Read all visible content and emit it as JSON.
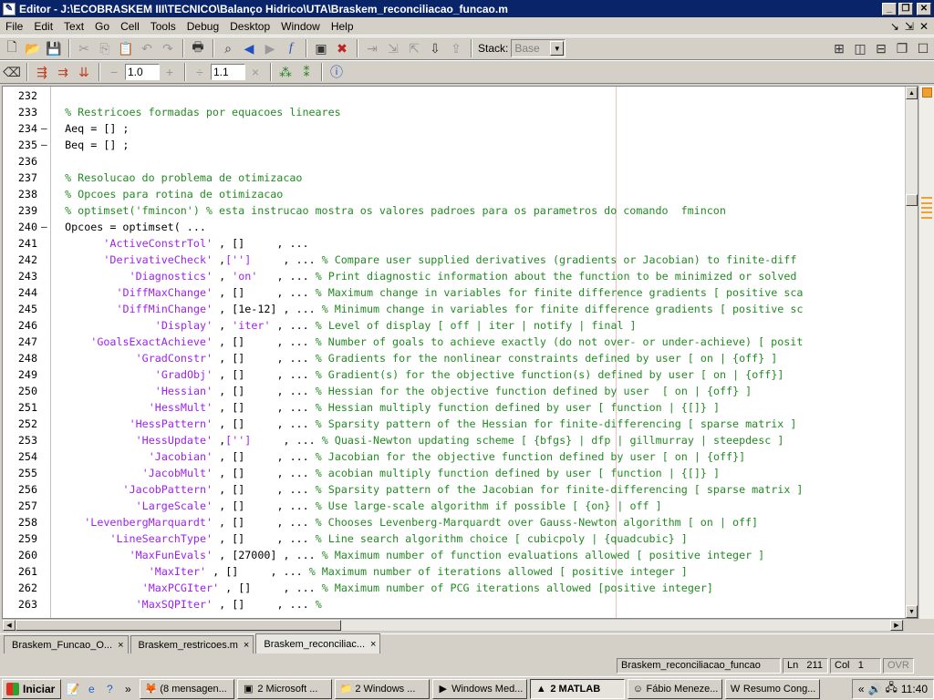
{
  "window": {
    "title": "Editor - J:\\ECOBRASKEM III\\TECNICO\\Balanço Hidrico\\UTA\\Braskem_reconciliacao_funcao.m"
  },
  "menu": [
    "File",
    "Edit",
    "Text",
    "Go",
    "Cell",
    "Tools",
    "Debug",
    "Desktop",
    "Window",
    "Help"
  ],
  "toolbar": {
    "stack_label": "Stack:",
    "stack_value": "Base",
    "cell_minus_value": "1.0",
    "cell_divide_value": "1.1"
  },
  "code_lines": [
    {
      "n": "232",
      "dash": "",
      "indent": 0,
      "parts": []
    },
    {
      "n": "233",
      "dash": "",
      "indent": 2,
      "parts": [
        {
          "t": "% Restricoes formadas por equacoes lineares",
          "c": "cm"
        }
      ]
    },
    {
      "n": "234",
      "dash": "—",
      "indent": 2,
      "parts": [
        {
          "t": "Aeq = [] ;",
          "c": "txt"
        }
      ]
    },
    {
      "n": "235",
      "dash": "—",
      "indent": 2,
      "parts": [
        {
          "t": "Beq = [] ;",
          "c": "txt"
        }
      ]
    },
    {
      "n": "236",
      "dash": "",
      "indent": 0,
      "parts": []
    },
    {
      "n": "237",
      "dash": "",
      "indent": 2,
      "parts": [
        {
          "t": "% Resolucao do problema de otimizacao",
          "c": "cm"
        }
      ]
    },
    {
      "n": "238",
      "dash": "",
      "indent": 2,
      "parts": [
        {
          "t": "% Opcoes para rotina de otimizacao",
          "c": "cm"
        }
      ]
    },
    {
      "n": "239",
      "dash": "",
      "indent": 2,
      "parts": [
        {
          "t": "% optimset('fmincon') % esta instrucao mostra os valores padroes para os parametros do comando  fmincon",
          "c": "cm"
        }
      ]
    },
    {
      "n": "240",
      "dash": "—",
      "indent": 2,
      "parts": [
        {
          "t": "Opcoes = optimset( ...",
          "c": "txt"
        }
      ]
    },
    {
      "n": "241",
      "dash": "",
      "indent": 8,
      "parts": [
        {
          "t": "'ActiveConstrTol'",
          "c": "str"
        },
        {
          "t": " , []     , ...",
          "c": "txt"
        }
      ]
    },
    {
      "n": "242",
      "dash": "",
      "indent": 8,
      "parts": [
        {
          "t": "'DerivativeCheck'",
          "c": "str"
        },
        {
          "t": " ,",
          "c": "txt"
        },
        {
          "t": "['']",
          "c": "str"
        },
        {
          "t": "     , ... ",
          "c": "txt"
        },
        {
          "t": "% Compare user supplied derivatives (gradients or Jacobian) to finite-diff",
          "c": "cm"
        }
      ]
    },
    {
      "n": "243",
      "dash": "",
      "indent": 12,
      "parts": [
        {
          "t": "'Diagnostics'",
          "c": "str"
        },
        {
          "t": " , ",
          "c": "txt"
        },
        {
          "t": "'on'",
          "c": "str"
        },
        {
          "t": "   , ... ",
          "c": "txt"
        },
        {
          "t": "% Print diagnostic information about the function to be minimized or solved",
          "c": "cm"
        }
      ]
    },
    {
      "n": "244",
      "dash": "",
      "indent": 10,
      "parts": [
        {
          "t": "'DiffMaxChange'",
          "c": "str"
        },
        {
          "t": " , []     , ... ",
          "c": "txt"
        },
        {
          "t": "% Maximum change in variables for finite difference gradients [ positive sca",
          "c": "cm"
        }
      ]
    },
    {
      "n": "245",
      "dash": "",
      "indent": 10,
      "parts": [
        {
          "t": "'DiffMinChange'",
          "c": "str"
        },
        {
          "t": " , [1e-12] , ... ",
          "c": "txt"
        },
        {
          "t": "% Minimum change in variables for finite difference gradients [ positive sc",
          "c": "cm"
        }
      ]
    },
    {
      "n": "246",
      "dash": "",
      "indent": 16,
      "parts": [
        {
          "t": "'Display'",
          "c": "str"
        },
        {
          "t": " , ",
          "c": "txt"
        },
        {
          "t": "'iter'",
          "c": "str"
        },
        {
          "t": " , ... ",
          "c": "txt"
        },
        {
          "t": "% Level of display [ off | iter | notify | final ]",
          "c": "cm"
        }
      ]
    },
    {
      "n": "247",
      "dash": "",
      "indent": 6,
      "parts": [
        {
          "t": "'GoalsExactAchieve'",
          "c": "str"
        },
        {
          "t": " , []     , ... ",
          "c": "txt"
        },
        {
          "t": "% Number of goals to achieve exactly (do not over- or under-achieve) [ posit",
          "c": "cm"
        }
      ]
    },
    {
      "n": "248",
      "dash": "",
      "indent": 13,
      "parts": [
        {
          "t": "'GradConstr'",
          "c": "str"
        },
        {
          "t": " , []     , ... ",
          "c": "txt"
        },
        {
          "t": "% Gradients for the nonlinear constraints defined by user [ on | {off} ]",
          "c": "cm"
        }
      ]
    },
    {
      "n": "249",
      "dash": "",
      "indent": 16,
      "parts": [
        {
          "t": "'GradObj'",
          "c": "str"
        },
        {
          "t": " , []     , ... ",
          "c": "txt"
        },
        {
          "t": "% Gradient(s) for the objective function(s) defined by user [ on | {off}]",
          "c": "cm"
        }
      ]
    },
    {
      "n": "250",
      "dash": "",
      "indent": 16,
      "parts": [
        {
          "t": "'Hessian'",
          "c": "str"
        },
        {
          "t": " , []     , ... ",
          "c": "txt"
        },
        {
          "t": "% Hessian for the objective function defined by user  [ on | {off} ]",
          "c": "cm"
        }
      ]
    },
    {
      "n": "251",
      "dash": "",
      "indent": 15,
      "parts": [
        {
          "t": "'HessMult'",
          "c": "str"
        },
        {
          "t": " , []     , ... ",
          "c": "txt"
        },
        {
          "t": "% Hessian multiply function defined by user [ function | {[]} ]",
          "c": "cm"
        }
      ]
    },
    {
      "n": "252",
      "dash": "",
      "indent": 12,
      "parts": [
        {
          "t": "'HessPattern'",
          "c": "str"
        },
        {
          "t": " , []     , ... ",
          "c": "txt"
        },
        {
          "t": "% Sparsity pattern of the Hessian for finite-differencing [ sparse matrix ]",
          "c": "cm"
        }
      ]
    },
    {
      "n": "253",
      "dash": "",
      "indent": 13,
      "parts": [
        {
          "t": "'HessUpdate'",
          "c": "str"
        },
        {
          "t": " ,",
          "c": "txt"
        },
        {
          "t": "['']",
          "c": "str"
        },
        {
          "t": "     , ... ",
          "c": "txt"
        },
        {
          "t": "% Quasi-Newton updating scheme [ {bfgs} | dfp | gillmurray | steepdesc ]",
          "c": "cm"
        }
      ]
    },
    {
      "n": "254",
      "dash": "",
      "indent": 15,
      "parts": [
        {
          "t": "'Jacobian'",
          "c": "str"
        },
        {
          "t": " , []     , ... ",
          "c": "txt"
        },
        {
          "t": "% Jacobian for the objective function defined by user [ on | {off}]",
          "c": "cm"
        }
      ]
    },
    {
      "n": "255",
      "dash": "",
      "indent": 14,
      "parts": [
        {
          "t": "'JacobMult'",
          "c": "str"
        },
        {
          "t": " , []     , ... ",
          "c": "txt"
        },
        {
          "t": "% acobian multiply function defined by user [ function | {[]} ]",
          "c": "cm"
        }
      ]
    },
    {
      "n": "256",
      "dash": "",
      "indent": 11,
      "parts": [
        {
          "t": "'JacobPattern'",
          "c": "str"
        },
        {
          "t": " , []     , ... ",
          "c": "txt"
        },
        {
          "t": "% Sparsity pattern of the Jacobian for finite-differencing [ sparse matrix ]",
          "c": "cm"
        }
      ]
    },
    {
      "n": "257",
      "dash": "",
      "indent": 13,
      "parts": [
        {
          "t": "'LargeScale'",
          "c": "str"
        },
        {
          "t": " , []     , ... ",
          "c": "txt"
        },
        {
          "t": "% Use large-scale algorithm if possible [ {on} | off ]",
          "c": "cm"
        }
      ]
    },
    {
      "n": "258",
      "dash": "",
      "indent": 5,
      "parts": [
        {
          "t": "'LevenbergMarquardt'",
          "c": "str"
        },
        {
          "t": " , []     , ... ",
          "c": "txt"
        },
        {
          "t": "% Chooses Levenberg-Marquardt over Gauss-Newton algorithm [ on | off]",
          "c": "cm"
        }
      ]
    },
    {
      "n": "259",
      "dash": "",
      "indent": 9,
      "parts": [
        {
          "t": "'LineSearchType'",
          "c": "str"
        },
        {
          "t": " , []     , ... ",
          "c": "txt"
        },
        {
          "t": "% Line search algorithm choice [ cubicpoly | {quadcubic} ]",
          "c": "cm"
        }
      ]
    },
    {
      "n": "260",
      "dash": "",
      "indent": 12,
      "parts": [
        {
          "t": "'MaxFunEvals'",
          "c": "str"
        },
        {
          "t": " , [27000] , ... ",
          "c": "txt"
        },
        {
          "t": "% Maximum number of function evaluations allowed [ positive integer ]",
          "c": "cm"
        }
      ]
    },
    {
      "n": "261",
      "dash": "",
      "indent": 15,
      "parts": [
        {
          "t": "'MaxIter'",
          "c": "str"
        },
        {
          "t": " , []     , ... ",
          "c": "txt"
        },
        {
          "t": "% Maximum number of iterations allowed [ positive integer ]",
          "c": "cm"
        }
      ]
    },
    {
      "n": "262",
      "dash": "",
      "indent": 14,
      "parts": [
        {
          "t": "'MaxPCGIter'",
          "c": "str"
        },
        {
          "t": " , []     , ... ",
          "c": "txt"
        },
        {
          "t": "% Maximum number of PCG iterations allowed [positive integer]",
          "c": "cm"
        }
      ]
    },
    {
      "n": "263",
      "dash": "",
      "indent": 13,
      "parts": [
        {
          "t": "'MaxSQPIter'",
          "c": "str"
        },
        {
          "t": " , []     , ... ",
          "c": "txt"
        },
        {
          "t": "%",
          "c": "cm"
        }
      ]
    }
  ],
  "tabs": [
    {
      "label": "Braskem_Funcao_O...",
      "close": "×",
      "active": false
    },
    {
      "label": "Braskem_restricoes.m",
      "close": "×",
      "active": false
    },
    {
      "label": "Braskem_reconciliac...",
      "close": "×",
      "active": true
    }
  ],
  "status": {
    "function_name": "Braskem_reconciliacao_funcao",
    "ln_label": "Ln",
    "ln_value": "211",
    "col_label": "Col",
    "col_value": "1",
    "ovr": "OVR"
  },
  "taskbar": {
    "start_label": "Iniciar",
    "tasks": [
      {
        "label": "(8 mensagen...",
        "icon": "firefox-icon",
        "active": false
      },
      {
        "label": "2 Microsoft ...",
        "icon": "office-icon",
        "active": false
      },
      {
        "label": "2 Windows ...",
        "icon": "folder-icon",
        "active": false
      },
      {
        "label": "Windows Med...",
        "icon": "media-player-icon",
        "active": false
      },
      {
        "label": "2 MATLAB",
        "icon": "matlab-icon",
        "active": true
      },
      {
        "label": "Fábio Meneze...",
        "icon": "messenger-icon",
        "active": false
      },
      {
        "label": "Resumo Cong...",
        "icon": "word-icon",
        "active": false
      }
    ],
    "clock": "11:40"
  },
  "colors": {
    "titlebar": "#0a246a",
    "comment": "#228b22",
    "string": "#a020f0"
  }
}
